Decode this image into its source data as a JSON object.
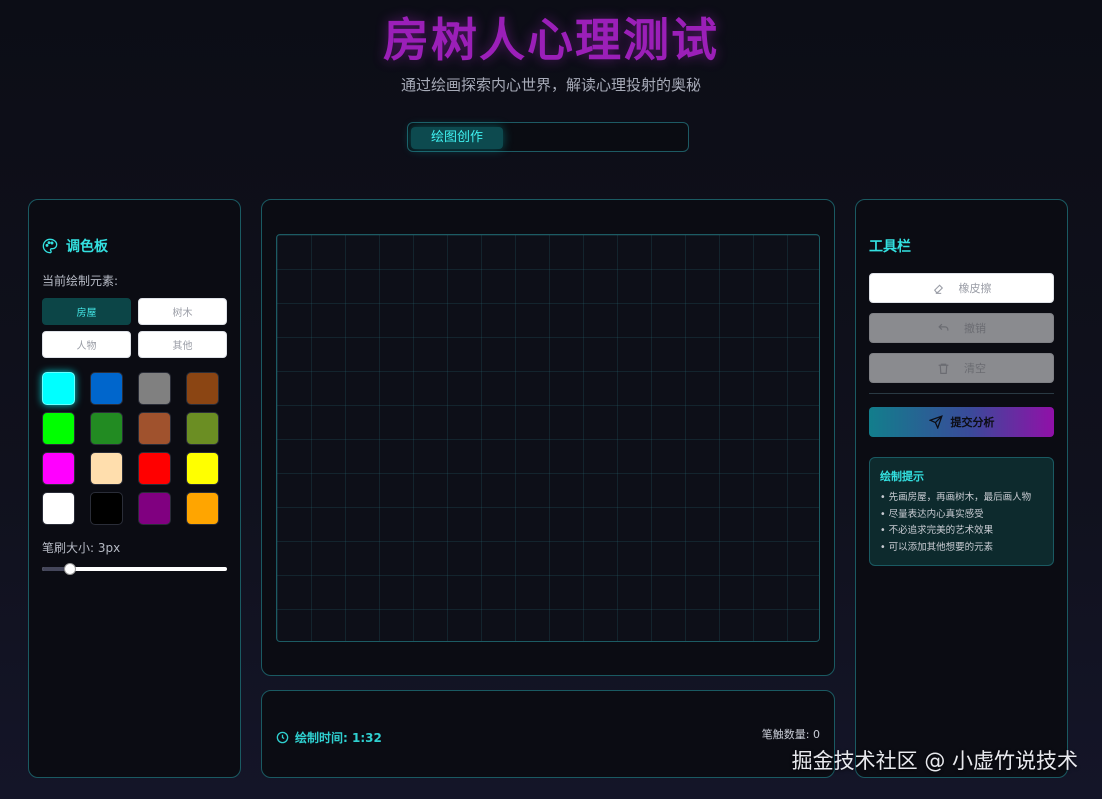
{
  "header": {
    "title": "房树人心理测试",
    "subtitle": "通过绘画探索内心世界，解读心理投射的奥秘"
  },
  "tabs": [
    {
      "label": "绘图创作",
      "active": true
    }
  ],
  "palette": {
    "title": "调色板",
    "icon": "palette-icon",
    "element_label": "当前绘制元素:",
    "elements": [
      {
        "label": "房屋",
        "active": true
      },
      {
        "label": "树木",
        "active": false
      },
      {
        "label": "人物",
        "active": false
      },
      {
        "label": "其他",
        "active": false
      }
    ],
    "colors": [
      {
        "name": "cyan",
        "hex": "#00ffff",
        "active": true
      },
      {
        "name": "blue",
        "hex": "#0066cc"
      },
      {
        "name": "gray",
        "hex": "#808080"
      },
      {
        "name": "brown",
        "hex": "#8b4513"
      },
      {
        "name": "green",
        "hex": "#00ff00"
      },
      {
        "name": "forest-green",
        "hex": "#228b22"
      },
      {
        "name": "sienna",
        "hex": "#a0522d"
      },
      {
        "name": "olive-drab",
        "hex": "#6b8e23"
      },
      {
        "name": "magenta",
        "hex": "#ff00ff"
      },
      {
        "name": "peach",
        "hex": "#ffdead"
      },
      {
        "name": "red",
        "hex": "#ff0000"
      },
      {
        "name": "yellow",
        "hex": "#ffff00"
      },
      {
        "name": "white",
        "hex": "#ffffff"
      },
      {
        "name": "black",
        "hex": "#000000"
      },
      {
        "name": "purple",
        "hex": "#800080"
      },
      {
        "name": "orange",
        "hex": "#ffa500"
      }
    ],
    "brush_label": "笔刷大小: 3px",
    "brush_fraction": 0.13
  },
  "status": {
    "timer_label": "绘制时间: 1:32",
    "stroke_label": "笔触数量: 0"
  },
  "toolbar": {
    "title": "工具栏",
    "eraser": "橡皮擦",
    "undo": "撤销",
    "clear": "清空",
    "submit": "提交分析"
  },
  "tips": {
    "title": "绘制提示",
    "items": [
      "先画房屋，再画树木，最后画人物",
      "尽量表达内心真实感受",
      "不必追求完美的艺术效果",
      "可以添加其他想要的元素"
    ]
  },
  "watermark": "掘金技术社区 @ 小虚竹说技术",
  "colors": {
    "accent": "#33e0e0",
    "title": "#9b1fb8",
    "panel_border": "#1a5a62"
  }
}
